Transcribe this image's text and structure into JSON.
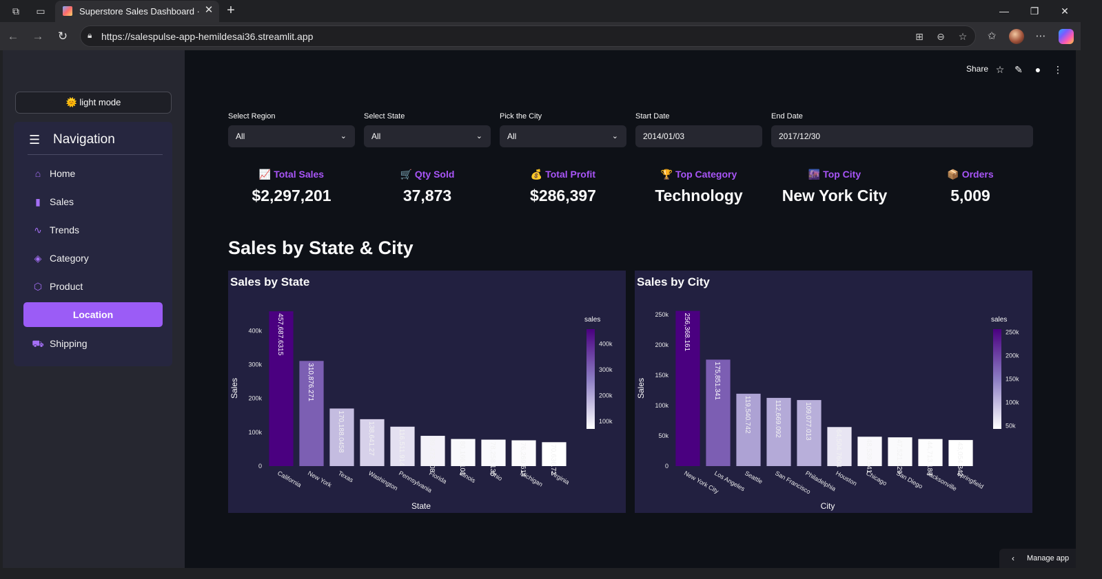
{
  "browser": {
    "tab_title": "Superstore Sales Dashboard · Stre",
    "url": "https://salespulse-app-hemildesai36.streamlit.app"
  },
  "app": {
    "light_mode_label": "🌞 light mode",
    "nav_title": "Navigation",
    "nav_items": [
      {
        "label": "Home",
        "icon": "home-icon"
      },
      {
        "label": "Sales",
        "icon": "bar-chart-icon"
      },
      {
        "label": "Trends",
        "icon": "pulse-icon"
      },
      {
        "label": "Category",
        "icon": "layers-icon"
      },
      {
        "label": "Product",
        "icon": "box-icon"
      },
      {
        "label": "Location",
        "icon": "map-pin-icon",
        "active": true
      },
      {
        "label": "Shipping",
        "icon": "truck-icon"
      }
    ],
    "share_label": "Share",
    "manage_label": "Manage app"
  },
  "filters": {
    "region": {
      "label": "Select Region",
      "value": "All"
    },
    "state": {
      "label": "Select State",
      "value": "All"
    },
    "city": {
      "label": "Pick the City",
      "value": "All"
    },
    "start": {
      "label": "Start Date",
      "value": "2014/01/03"
    },
    "end": {
      "label": "End Date",
      "value": "2017/12/30"
    }
  },
  "kpis": [
    {
      "label": "📈 Total Sales",
      "value": "$2,297,201"
    },
    {
      "label": "🛒 Qty Sold",
      "value": "37,873"
    },
    {
      "label": "💰 Total Profit",
      "value": "$286,397"
    },
    {
      "label": "🏆 Top Category",
      "value": "Technology"
    },
    {
      "label": "🌆 Top City",
      "value": "New York City"
    },
    {
      "label": "📦 Orders",
      "value": "5,009"
    }
  ],
  "section_title": "Sales by State & City",
  "accent_color": "#9b5cf6",
  "chart_data": [
    {
      "type": "bar",
      "title": "Sales by State",
      "xlabel": "State",
      "ylabel": "Sales",
      "categories": [
        "California",
        "New York",
        "Texas",
        "Washington",
        "Pennsylvania",
        "Florida",
        "Illinois",
        "Ohio",
        "Michigan",
        "Virginia"
      ],
      "values": [
        457687.6315,
        310876.271,
        170188.0458,
        138641.27,
        116511.914,
        89473.708,
        80166.101,
        78258.136,
        76269.614,
        70636.72
      ],
      "labels": [
        "457,687.6315",
        "310,876.271",
        "170,188.0458",
        "138,641.27",
        "116,511.914",
        "89,473.708",
        "80,166.101",
        "78,258.136",
        "76,269.614",
        "70,636.72"
      ],
      "ylim": [
        0,
        460000
      ],
      "yticks": [
        0,
        100000,
        200000,
        300000,
        400000
      ],
      "ytick_labels": [
        "0",
        "100k",
        "200k",
        "300k",
        "400k"
      ],
      "legend_title": "sales",
      "legend_ticks": [
        "400k",
        "300k",
        "200k",
        "100k"
      ],
      "legend_tick_values": [
        400000,
        300000,
        200000,
        100000
      ],
      "colorscale": [
        "#ffffff",
        "#4a0080"
      ]
    },
    {
      "type": "bar",
      "title": "Sales by City",
      "xlabel": "City",
      "ylabel": "Sales",
      "categories": [
        "New York City",
        "Los Angeles",
        "Seattle",
        "San Francisco",
        "Philadelphia",
        "Houston",
        "Chicago",
        "San Diego",
        "Jacksonville",
        "Springfield"
      ],
      "values": [
        256368.161,
        175851.341,
        119540.742,
        112669.092,
        109077.013,
        64504.7604,
        48539.541,
        47521.029,
        44713.183,
        43054.342
      ],
      "labels": [
        "256,368.161",
        "175,851.341",
        "119,540.742",
        "112,669.092",
        "109,077.013",
        "64,504.7604",
        "48,539.541",
        "47,521.029",
        "44,713.183",
        "43,054.342"
      ],
      "ylim": [
        0,
        257000
      ],
      "yticks": [
        0,
        50000,
        100000,
        150000,
        200000,
        250000
      ],
      "ytick_labels": [
        "0",
        "50k",
        "100k",
        "150k",
        "200k",
        "250k"
      ],
      "legend_title": "sales",
      "legend_ticks": [
        "250k",
        "200k",
        "150k",
        "100k",
        "50k"
      ],
      "legend_tick_values": [
        250000,
        200000,
        150000,
        100000,
        50000
      ],
      "colorscale": [
        "#ffffff",
        "#4a0080"
      ]
    }
  ]
}
